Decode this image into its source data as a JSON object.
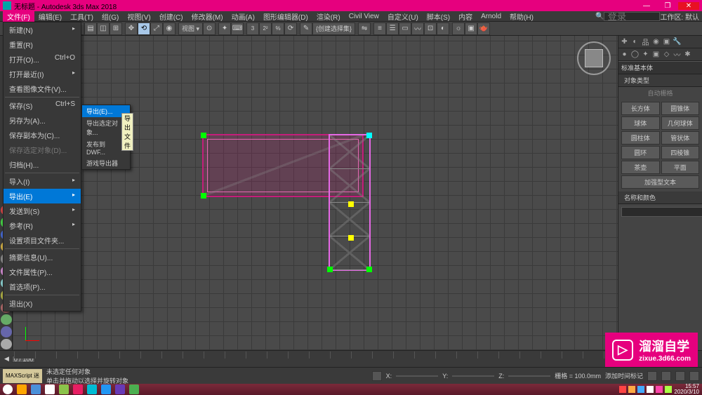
{
  "titlebar": {
    "title": "无标题 - Autodesk 3ds Max 2018"
  },
  "search_placeholder": "登录",
  "menubar": {
    "items": [
      "文件(F)",
      "编辑(E)",
      "工具(T)",
      "组(G)",
      "视图(V)",
      "创建(C)",
      "修改器(M)",
      "动画(A)",
      "图形编辑器(D)",
      "渲染(R)",
      "Civil View",
      "自定义(U)",
      "脚本(S)",
      "内容",
      "Arnold",
      "帮助(H)"
    ],
    "right": [
      "工作区: 默认"
    ]
  },
  "toolbar": {
    "dropdown_label": "{创建选择集}"
  },
  "file_menu": {
    "items": [
      {
        "label": "新建(N)",
        "arrow": true
      },
      {
        "label": "重置(R)"
      },
      {
        "label": "打开(O)...",
        "shortcut": "Ctrl+O"
      },
      {
        "label": "打开最近(I)",
        "arrow": true
      },
      {
        "label": "查看图像文件(V)..."
      },
      {
        "sep": true
      },
      {
        "label": "保存(S)",
        "shortcut": "Ctrl+S"
      },
      {
        "label": "另存为(A)..."
      },
      {
        "label": "保存副本为(C)..."
      },
      {
        "label": "保存选定对象(D)...",
        "disabled": true
      },
      {
        "label": "归档(H)..."
      },
      {
        "sep": true
      },
      {
        "label": "导入(I)",
        "arrow": true
      },
      {
        "label": "导出(E)",
        "arrow": true,
        "highlight": true
      },
      {
        "label": "发送到(S)",
        "arrow": true
      },
      {
        "label": "参考(R)",
        "arrow": true
      },
      {
        "label": "设置项目文件夹..."
      },
      {
        "sep": true
      },
      {
        "label": "摘要信息(U)..."
      },
      {
        "label": "文件属性(P)..."
      },
      {
        "label": "首选项(P)..."
      },
      {
        "sep": true
      },
      {
        "label": "退出(X)"
      }
    ]
  },
  "export_submenu": {
    "items": [
      {
        "label": "导出(E)...",
        "highlight": true,
        "tooltip": "导出文件"
      },
      {
        "label": "导出选定对象..."
      },
      {
        "label": "发布到 DWF..."
      },
      {
        "label": "游戏导出器"
      }
    ]
  },
  "right_panel": {
    "header": "标准基本体",
    "section1": "对象类型",
    "autogrid": "自动栅格",
    "buttons": [
      "长方体",
      "圆锥体",
      "球体",
      "几何球体",
      "圆柱体",
      "管状体",
      "圆环",
      "四棱锥",
      "茶壶",
      "平面",
      "加强型文本"
    ],
    "section2": "名称和颜色"
  },
  "timeline": {
    "range": "0 / 100"
  },
  "statusbar": {
    "script_label": "MAXScript 迷",
    "msg1": "未选定任何对象",
    "msg2": "单击并拖动以选择并旋转对象",
    "x": "X:",
    "y": "Y:",
    "z": "Z:",
    "grid": "栅格 = 100.0mm",
    "autokey": "添加时间标记"
  },
  "taskbar": {
    "time": "15:57",
    "date": "2020/3/10"
  },
  "watermark": {
    "main": "溜溜自学",
    "sub": "zixue.3d66.com"
  }
}
